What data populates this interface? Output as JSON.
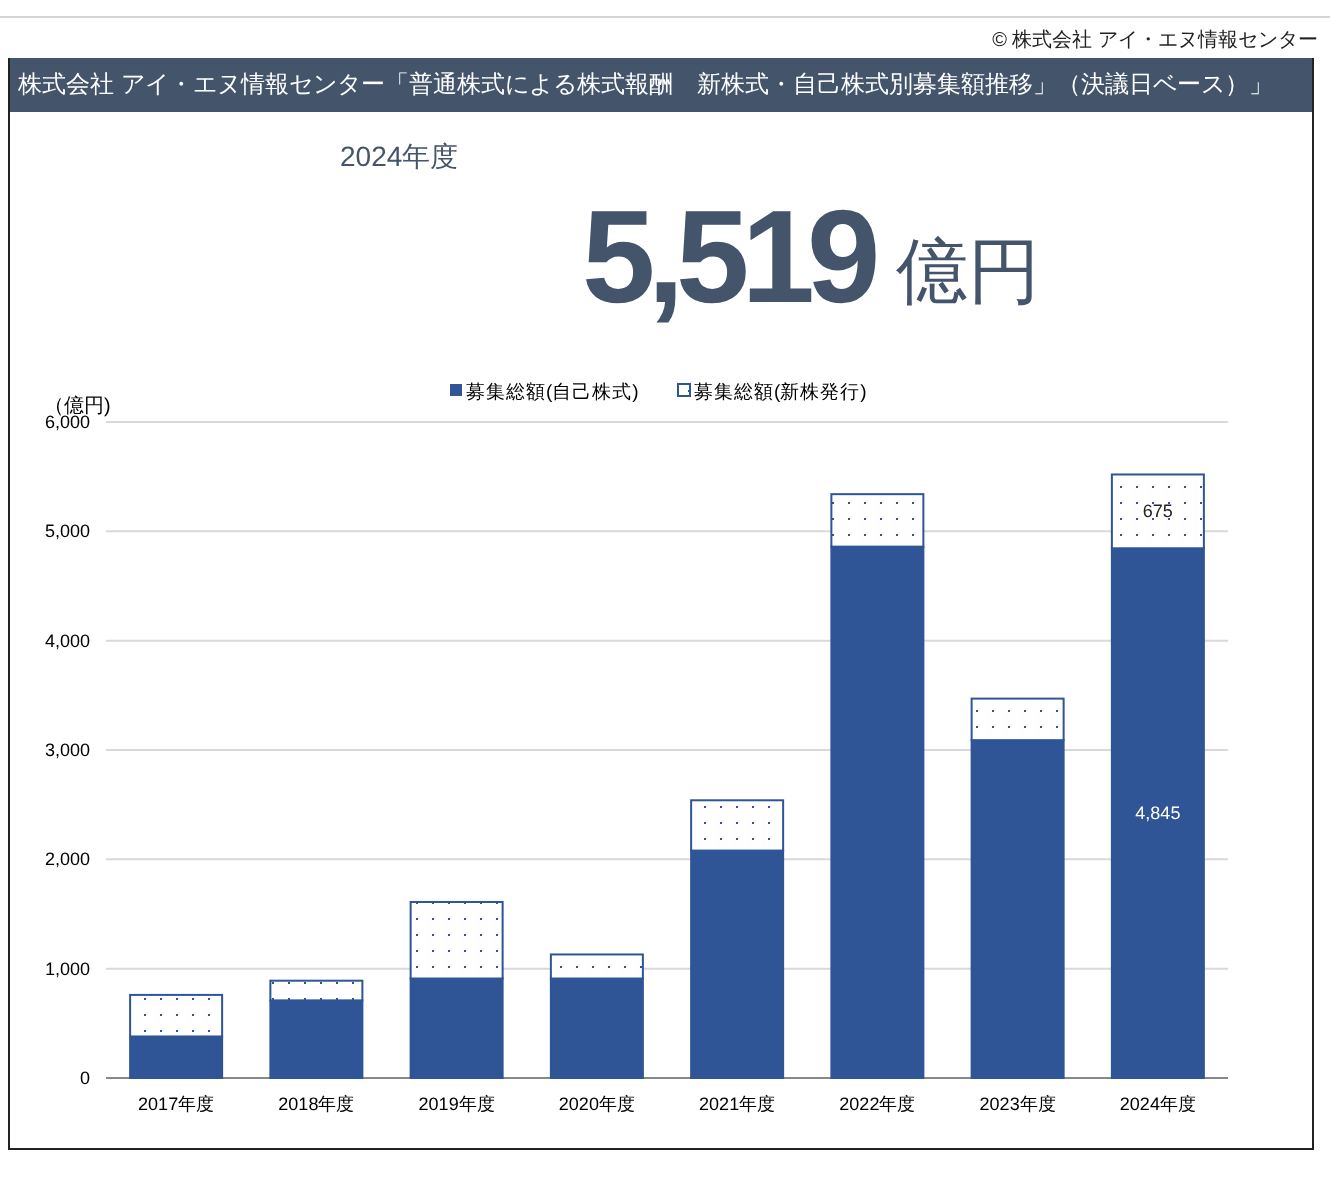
{
  "copyright": "© 株式会社 アイ・エヌ情報センター",
  "title_bar": "株式会社 アイ・エヌ情報センター「普通株式による株式報酬　新株式・自己株式別募集額推移」（決議日ベース）」",
  "headline": {
    "period": "2024年度",
    "amount": "5,519",
    "unit": "億円"
  },
  "chart_data": {
    "type": "bar",
    "stacked": true,
    "ylabel": "（億円)",
    "categories": [
      "2017年度",
      "2018年度",
      "2019年度",
      "2020年度",
      "2021年度",
      "2022年度",
      "2023年度",
      "2024年度"
    ],
    "series": [
      {
        "name": "募集総額(自己株式)",
        "color": "#2f5597",
        "values": [
          380,
          710,
          910,
          910,
          2080,
          4860,
          3090,
          4845
        ]
      },
      {
        "name": "募集総額(新株発行)",
        "color": "#2f5597",
        "values": [
          380,
          180,
          700,
          220,
          460,
          480,
          380,
          675
        ]
      }
    ],
    "grid": true,
    "legend": true,
    "ylim": [
      0,
      6000
    ],
    "yticks": [
      {
        "value": 0,
        "label": "0"
      },
      {
        "value": 1000,
        "label": "1,000"
      },
      {
        "value": 2000,
        "label": "2,000"
      },
      {
        "value": 3000,
        "label": "3,000"
      },
      {
        "value": 4000,
        "label": "4,000"
      },
      {
        "value": 5000,
        "label": "5,000"
      },
      {
        "value": 6000,
        "label": "6,000"
      }
    ],
    "annotations": [
      "4,845",
      "675"
    ]
  }
}
